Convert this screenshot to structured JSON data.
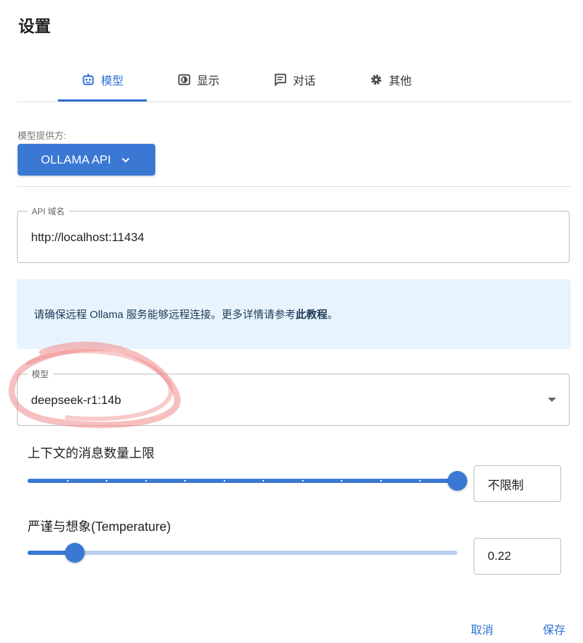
{
  "page": {
    "title": "设置"
  },
  "tabs": [
    {
      "label": "模型",
      "icon": "robot-icon",
      "active": true
    },
    {
      "label": "显示",
      "icon": "display-icon",
      "active": false
    },
    {
      "label": "对话",
      "icon": "chat-icon",
      "active": false
    },
    {
      "label": "其他",
      "icon": "gear-icon",
      "active": false
    }
  ],
  "provider": {
    "label": "模型提供方:",
    "value": "OLLAMA API"
  },
  "api_host": {
    "legend": "API 域名",
    "value": "http://localhost:11434"
  },
  "info": {
    "text": "请确保远程 Ollama 服务能够远程连接。更多详情请参考",
    "link": "此教程",
    "suffix": "。"
  },
  "model": {
    "legend": "模型",
    "value": "deepseek-r1:14b"
  },
  "context_limit": {
    "label": "上下文的消息数量上限",
    "value": "不限制",
    "slider_fraction": 1.0
  },
  "temperature": {
    "label": "严谨与想象(Temperature)",
    "value": "0.22",
    "slider_fraction": 0.11
  },
  "footer": {
    "cancel": "取消",
    "save": "保存"
  },
  "colors": {
    "accent": "#3a78d4",
    "info_bg": "#e8f4fd",
    "annotation": "#f08a8a"
  }
}
